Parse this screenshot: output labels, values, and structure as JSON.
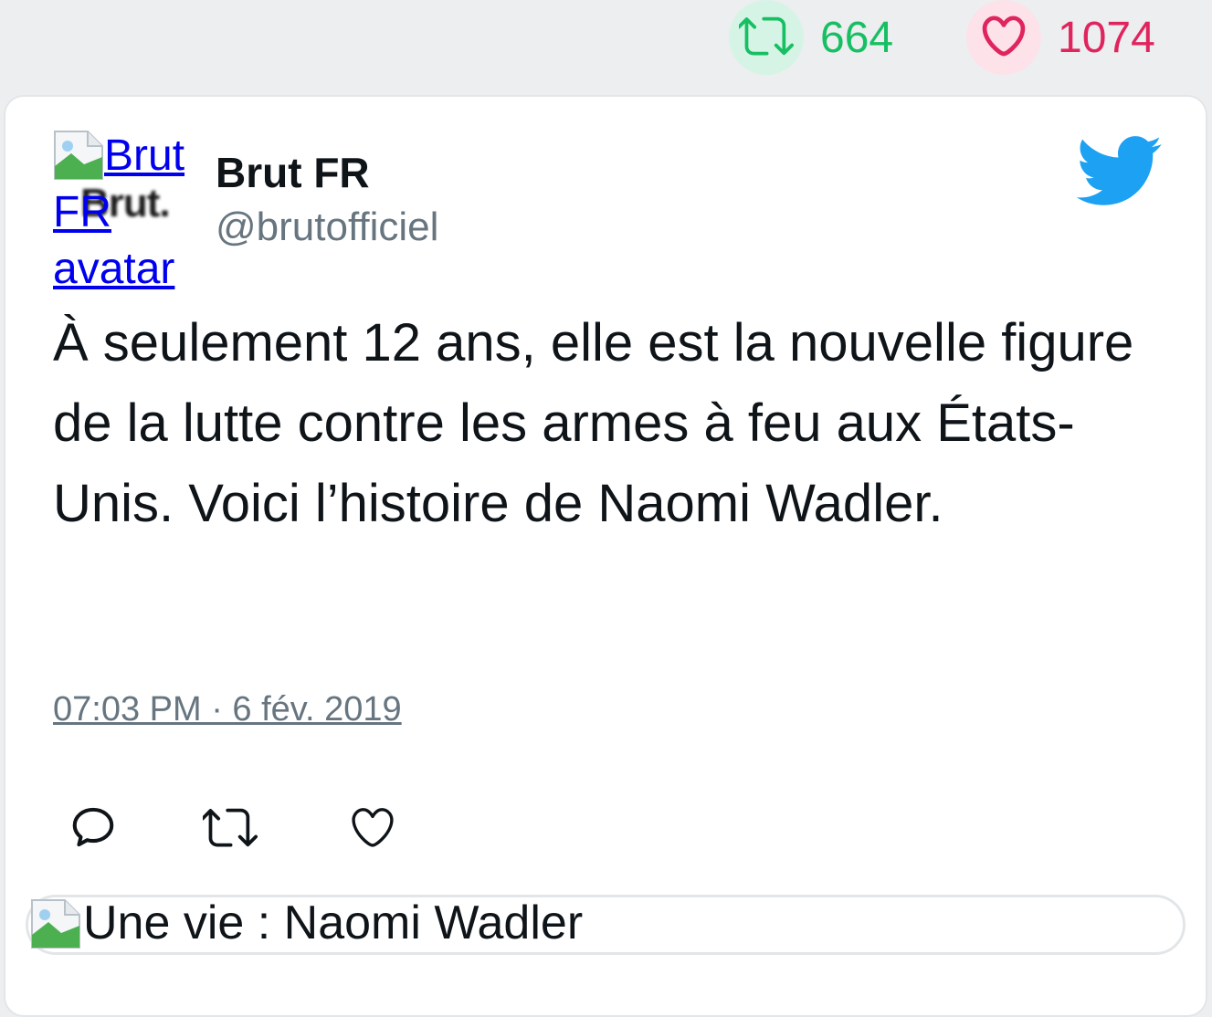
{
  "stats": {
    "retweet_count": "664",
    "like_count": "1074"
  },
  "tweet": {
    "avatar_alt": "Brut FR avatar",
    "avatar_logo_text": "Brut.",
    "author_name": "Brut FR",
    "author_handle": "@brutofficiel",
    "text": "À seulement 12 ans, elle est la nouvelle figure de la lutte contre les armes à feu aux États-Unis. Voici l’histoire de Naomi Wadler.",
    "timestamp": "07:03 PM · 6 fév. 2019",
    "media_alt": "Une vie : Naomi Wadler"
  },
  "icons": {
    "retweet": "retweet-icon",
    "like": "heart-icon",
    "reply": "reply-icon",
    "brand": "twitter-bird-icon",
    "broken_image": "broken-image-icon"
  },
  "colors": {
    "retweet_green": "#17bf63",
    "like_red": "#e0245e",
    "twitter_blue": "#1da1f2",
    "secondary_text": "#66757f"
  }
}
